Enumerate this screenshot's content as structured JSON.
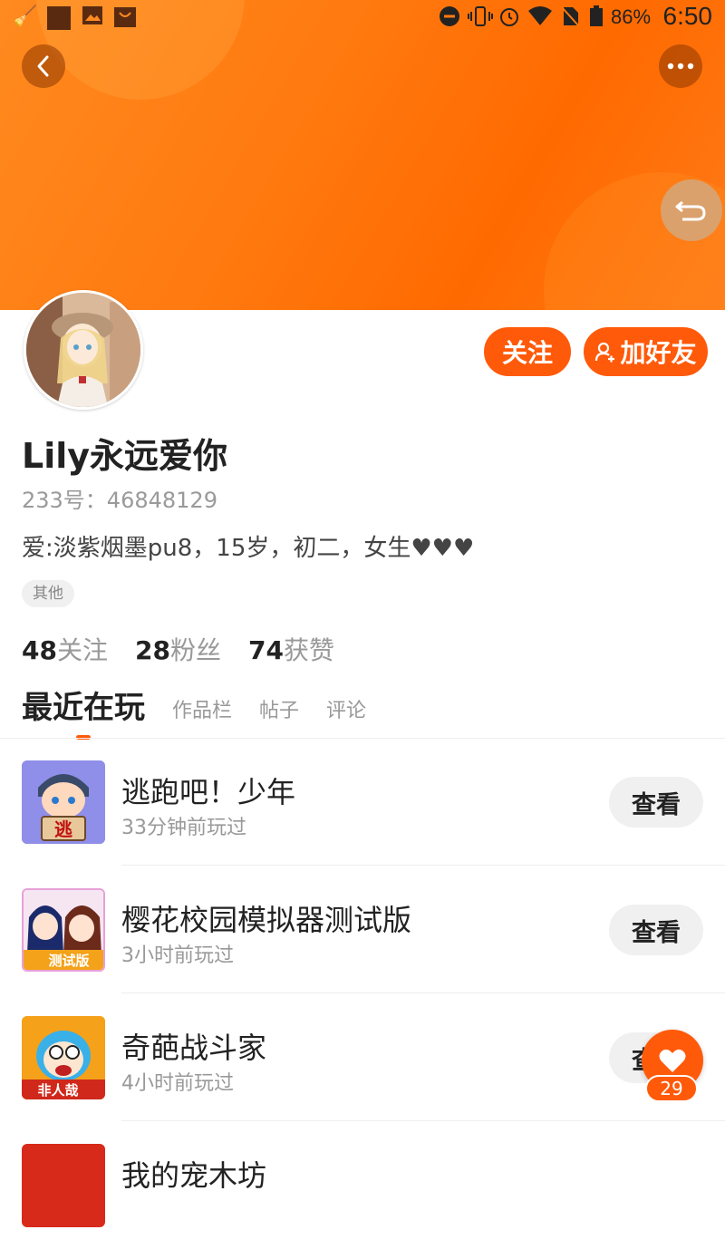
{
  "status_bar": {
    "battery": "86%",
    "time": "6:50"
  },
  "profile": {
    "name": "Lily永远爱你",
    "id_line": "233号：46848129",
    "bio": "爱:淡紫烟墨pu8，15岁，初二，女生♥♥♥",
    "tag": "其他",
    "follow_label": "关注",
    "add_friend_label": "加好友"
  },
  "stats": [
    {
      "num": "48",
      "label": "关注"
    },
    {
      "num": "28",
      "label": "粉丝"
    },
    {
      "num": "74",
      "label": "获赞"
    }
  ],
  "tabs": [
    "最近在玩",
    "作品栏",
    "帖子",
    "评论"
  ],
  "games": [
    {
      "title": "逃跑吧！少年",
      "time": "33分钟前玩过",
      "button": "查看",
      "icon_text": "逃"
    },
    {
      "title": "樱花校园模拟器测试版",
      "time": "3小时前玩过",
      "button": "查看",
      "icon_text": "测试版"
    },
    {
      "title": "奇葩战斗家",
      "time": "4小时前玩过",
      "button": "查看",
      "icon_text": "非人哉"
    },
    {
      "title": "我的宠木坊",
      "time": "",
      "button": "",
      "icon_text": ""
    }
  ],
  "like": {
    "count": "29"
  },
  "colors": {
    "accent": "#ff5a0a",
    "banner": "#ff7a10"
  }
}
